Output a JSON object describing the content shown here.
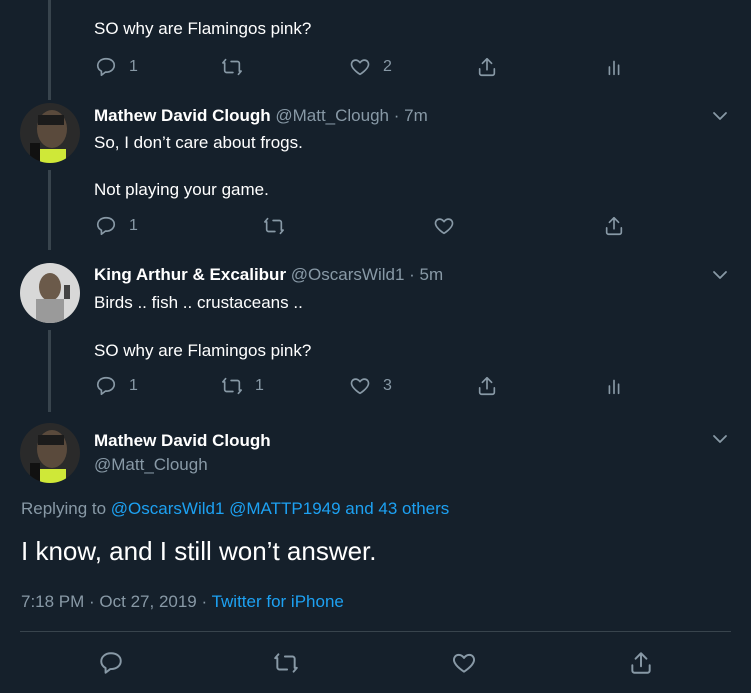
{
  "tweets": [
    {
      "text": "SO why are Flamingos pink?",
      "reply_count": "1",
      "retweet_count": "",
      "like_count": "2"
    },
    {
      "name": "Mathew David Clough",
      "handle": "@Matt_Clough",
      "time": "· 7m",
      "line1": "So, I don’t care about frogs.",
      "line2": "Not playing your game.",
      "reply_count": "1",
      "retweet_count": "",
      "like_count": ""
    },
    {
      "name": "King Arthur & Excalibur",
      "handle": "@OscarsWild1",
      "time": "· 5m",
      "line1": "Birds .. fish .. crustaceans ..",
      "line2": "SO why are Flamingos pink?",
      "reply_count": "1",
      "retweet_count": "1",
      "like_count": "3"
    }
  ],
  "main": {
    "name": "Mathew David Clough",
    "handle": "@Matt_Clough",
    "replying_prefix": "Replying to",
    "replying_1": "@OscarsWild1",
    "replying_2": "@MATTP1949",
    "replying_3": "and 43 others",
    "text": "I know, and I still won’t answer.",
    "timestamp": "7:18 PM · Oct 27, 2019 ·",
    "source": "Twitter for iPhone"
  },
  "colors": {
    "background": "#15202b",
    "text_secondary": "#8899a6",
    "link": "#1da1f2"
  },
  "icons": [
    "reply-icon",
    "retweet-icon",
    "like-icon",
    "share-icon",
    "analytics-icon",
    "caret-down-icon"
  ]
}
